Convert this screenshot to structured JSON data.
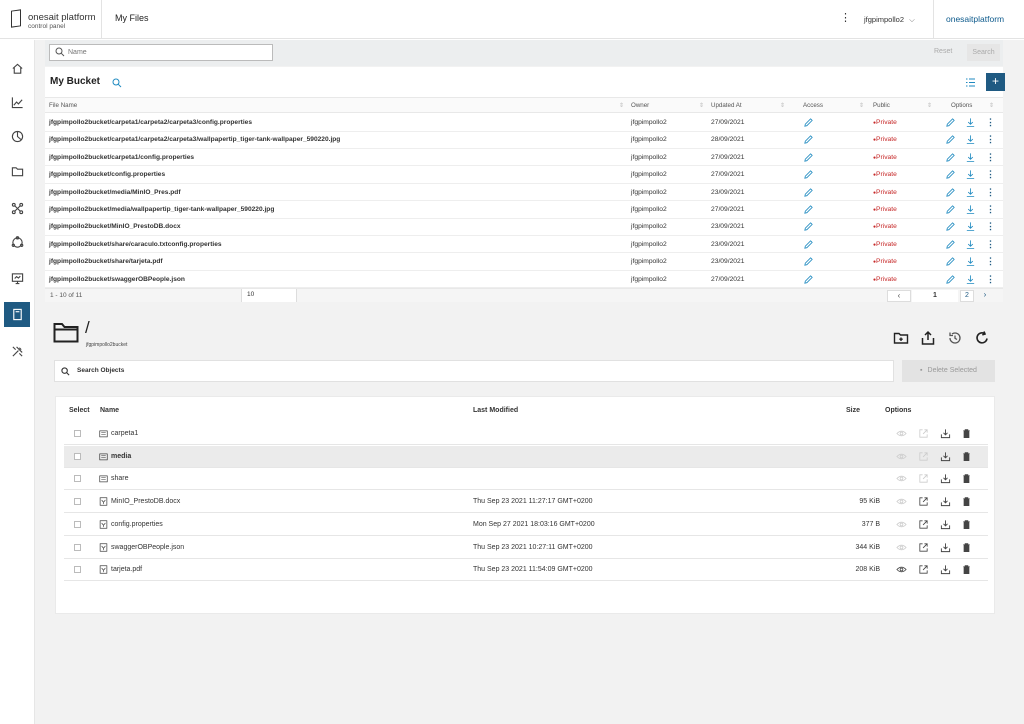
{
  "topbar": {
    "logo_brand": "onesait platform",
    "logo_sub": "control panel",
    "title": "My Files",
    "user": "jfgpimpollo2",
    "user_chevron": "⌵",
    "kebab": "⋮",
    "brand_link": "onesaitplatform"
  },
  "sidebar": {
    "items": [
      "home-icon",
      "chart-icon",
      "pie-icon",
      "folder-icon",
      "network-icon",
      "cycle-icon",
      "monitor-icon",
      "book-icon",
      "tools-icon"
    ],
    "active_index": 7
  },
  "filter": {
    "placeholder": "Name",
    "reset": "Reset",
    "search": "Search"
  },
  "bucket": {
    "title": "My Bucket",
    "add": "+",
    "columns": {
      "file_name": "File Name",
      "owner": "Owner",
      "updated_at": "Updated At",
      "access": "Access",
      "public": "Public",
      "options": "Options"
    },
    "rows": [
      {
        "name": "jfgpimpollo2bucket/carpeta1/carpeta2/carpeta3/config.properties",
        "owner": "jfgpimpollo2",
        "updated": "27/09/2021",
        "public": "Private"
      },
      {
        "name": "jfgpimpollo2bucket/carpeta1/carpeta2/carpeta3/wallpapertip_tiger-tank-wallpaper_590220.jpg",
        "owner": "jfgpimpollo2",
        "updated": "28/09/2021",
        "public": "Private"
      },
      {
        "name": "jfgpimpollo2bucket/carpeta1/config.properties",
        "owner": "jfgpimpollo2",
        "updated": "27/09/2021",
        "public": "Private"
      },
      {
        "name": "jfgpimpollo2bucket/config.properties",
        "owner": "jfgpimpollo2",
        "updated": "27/09/2021",
        "public": "Private"
      },
      {
        "name": "jfgpimpollo2bucket/media/MinIO_Pres.pdf",
        "owner": "jfgpimpollo2",
        "updated": "23/09/2021",
        "public": "Private"
      },
      {
        "name": "jfgpimpollo2bucket/media/wallpapertip_tiger-tank-wallpaper_590220.jpg",
        "owner": "jfgpimpollo2",
        "updated": "27/09/2021",
        "public": "Private"
      },
      {
        "name": "jfgpimpollo2bucket/MinIO_PrestoDB.docx",
        "owner": "jfgpimpollo2",
        "updated": "23/09/2021",
        "public": "Private"
      },
      {
        "name": "jfgpimpollo2bucket/share/caraculo.txtconfig.properties",
        "owner": "jfgpimpollo2",
        "updated": "23/09/2021",
        "public": "Private"
      },
      {
        "name": "jfgpimpollo2bucket/share/tarjeta.pdf",
        "owner": "jfgpimpollo2",
        "updated": "23/09/2021",
        "public": "Private"
      },
      {
        "name": "jfgpimpollo2bucket/swaggerOBPeople.json",
        "owner": "jfgpimpollo2",
        "updated": "27/09/2021",
        "public": "Private"
      }
    ],
    "pager": {
      "range": "1 - 10 of 11",
      "page_size": "10",
      "prev": "‹",
      "current": "1",
      "next_page": "2",
      "next": "›"
    }
  },
  "explorer": {
    "path": "/",
    "bucket": "jfgpimpollo2bucket",
    "search_placeholder": "Search Objects",
    "delete_selected": "Delete Selected",
    "columns": {
      "select": "Select",
      "name": "Name",
      "last_modified": "Last Modified",
      "size": "Size",
      "options": "Options"
    },
    "rows": [
      {
        "type": "folder",
        "name": "carpeta1",
        "modified": "",
        "size": "",
        "bold": false,
        "highlight": false
      },
      {
        "type": "folder",
        "name": "media",
        "modified": "",
        "size": "",
        "bold": true,
        "highlight": true
      },
      {
        "type": "folder",
        "name": "share",
        "modified": "",
        "size": "",
        "bold": false,
        "highlight": false
      },
      {
        "type": "file",
        "name": "MinIO_PrestoDB.docx",
        "modified": "Thu Sep 23 2021 11:27:17 GMT+0200",
        "size": "95 KiB",
        "bold": false,
        "highlight": false
      },
      {
        "type": "file",
        "name": "config.properties",
        "modified": "Mon Sep 27 2021 18:03:16 GMT+0200",
        "size": "377 B",
        "bold": false,
        "highlight": false
      },
      {
        "type": "file",
        "name": "swaggerOBPeople.json",
        "modified": "Thu Sep 23 2021 10:27:11 GMT+0200",
        "size": "344 KiB",
        "bold": false,
        "highlight": false
      },
      {
        "type": "file",
        "name": "tarjeta.pdf",
        "modified": "Thu Sep 23 2021 11:54:09 GMT+0200",
        "size": "208 KiB",
        "bold": false,
        "highlight": false
      }
    ]
  },
  "colors": {
    "accent": "#1f5a82",
    "private": "#c62828",
    "link": "#0d5a8c"
  }
}
